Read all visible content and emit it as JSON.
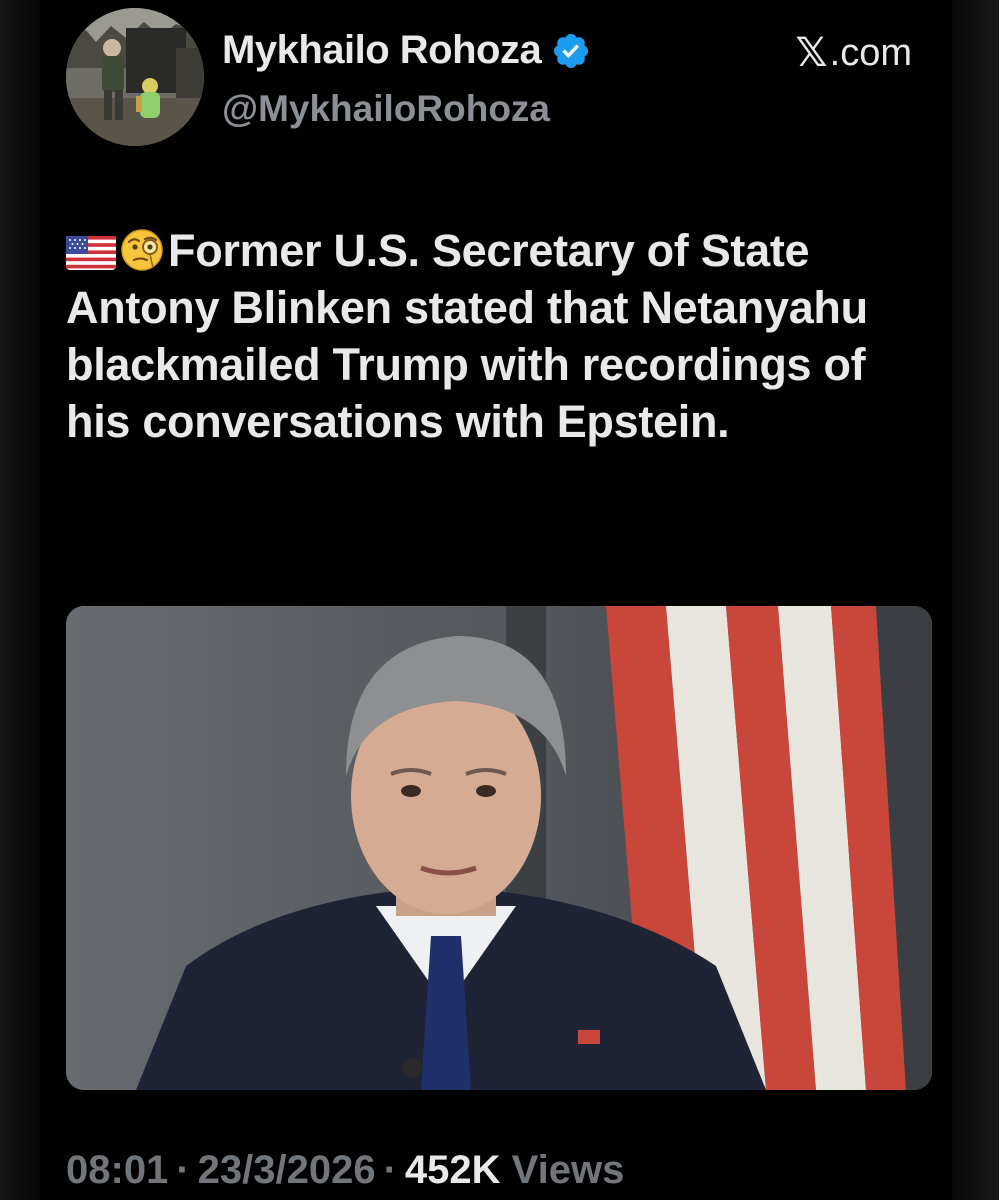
{
  "author": {
    "display_name": "Mykhailo Rohoza",
    "handle": "@MykhailoRohoza",
    "verified": true,
    "verified_color": "#1d9bf0"
  },
  "source": {
    "logo": "𝕏",
    "label": ".com"
  },
  "tweet": {
    "leading_emoji_icons": [
      "us-flag-icon",
      "face-with-monocle-icon"
    ],
    "text": "Former U.S. Secretary of State Antony Blinken stated that Netanyahu blackmailed Trump with recordings of his conversations with Epstein."
  },
  "media": {
    "type": "photo"
  },
  "meta": {
    "time": "08:01",
    "separator": "·",
    "date": "23/3/2026",
    "views_count": "452K",
    "views_label": "Views"
  },
  "colors": {
    "background": "#000000",
    "text_primary": "#e7e9ea",
    "text_secondary": "#71767b"
  }
}
